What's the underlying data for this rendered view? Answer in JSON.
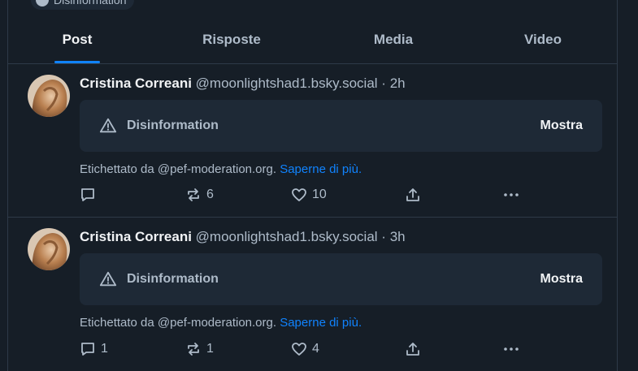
{
  "top_pill": {
    "label": "Disinformation"
  },
  "tabs": [
    {
      "label": "Post"
    },
    {
      "label": "Risposte"
    },
    {
      "label": "Media"
    },
    {
      "label": "Video"
    }
  ],
  "posts": [
    {
      "author_name": "Cristina Correani",
      "handle": "@moonlightshad1.bsky.social",
      "separator": "·",
      "time": "2h",
      "warning_label": "Disinformation",
      "show_label": "Mostra",
      "labeled_by": "Etichettato da @pef-moderation.org.",
      "learn_more": "Saperne di più.",
      "replies": "",
      "reposts": "6",
      "likes": "10"
    },
    {
      "author_name": "Cristina Correani",
      "handle": "@moonlightshad1.bsky.social",
      "separator": "·",
      "time": "3h",
      "warning_label": "Disinformation",
      "show_label": "Mostra",
      "labeled_by": "Etichettato da @pef-moderation.org.",
      "learn_more": "Saperne di più.",
      "replies": "1",
      "reposts": "1",
      "likes": "4"
    }
  ],
  "icons": {
    "reply": "reply-icon",
    "repost": "repost-icon",
    "like": "heart-icon",
    "share": "share-icon",
    "more": "more-options-icon",
    "warning": "warning-triangle-icon"
  },
  "colors": {
    "background": "#161e27",
    "card": "#1e2936",
    "accent": "#1083fe",
    "muted_text": "#aebbc9",
    "border": "#2e3a48"
  }
}
